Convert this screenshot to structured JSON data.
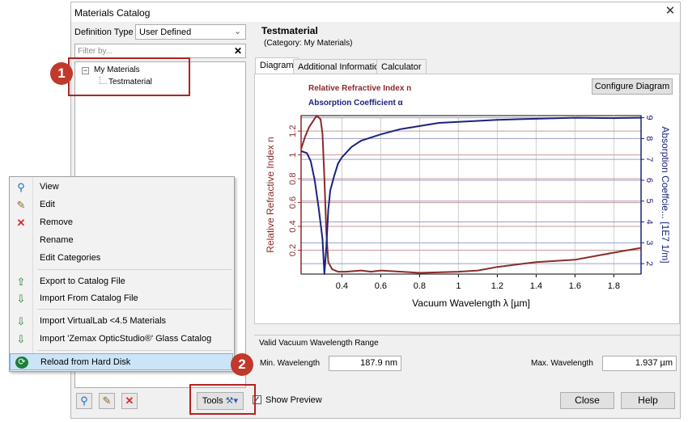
{
  "window": {
    "title": "Materials Catalog",
    "close": "✕"
  },
  "left": {
    "definition_label": "Definition Type",
    "definition_value": "User Defined",
    "filter_placeholder": "Filter by...",
    "filter_clear": "✕",
    "tree": {
      "root": "My Materials",
      "child": "Testmaterial",
      "expander": "−"
    },
    "tools_label": "Tools"
  },
  "material": {
    "name": "Testmaterial",
    "category": "(Category: My Materials)"
  },
  "tabs": [
    "Diagram",
    "Additional Information",
    "Calculator"
  ],
  "diagram": {
    "configure_button": "Configure Diagram",
    "legend_n": "Relative Refractive Index n",
    "legend_alpha": "Absorption Coefficient α"
  },
  "chart_data": {
    "type": "line",
    "xlabel": "Vacuum Wavelength λ [µm]",
    "ylabel": "Relative Refractive Index n",
    "y2label": "Absorption Coeffcie... [1E7 1/m]",
    "xlim": [
      0.19,
      1.94
    ],
    "ylim": [
      0.0,
      1.33
    ],
    "y2lim": [
      1.5,
      9.1
    ],
    "xticks": [
      "0.4",
      "0.6",
      "0.8",
      "1",
      "1.2",
      "1.4",
      "1.6",
      "1.8"
    ],
    "yticks": [
      "0.2",
      "0.4",
      "0.6",
      "0.8",
      "1",
      "1.2"
    ],
    "y2ticks": [
      "2",
      "3",
      "4",
      "5",
      "6",
      "7",
      "8",
      "9"
    ],
    "series": [
      {
        "name": "Relative Refractive Index n",
        "color": "#8b2a2a",
        "axis": "left",
        "x": [
          0.19,
          0.21,
          0.23,
          0.25,
          0.27,
          0.29,
          0.3,
          0.31,
          0.32,
          0.33,
          0.35,
          0.38,
          0.42,
          0.5,
          0.55,
          0.6,
          0.8,
          1.0,
          1.1,
          1.2,
          1.4,
          1.6,
          1.7,
          1.8,
          1.94
        ],
        "y": [
          1.05,
          1.15,
          1.23,
          1.28,
          1.33,
          1.3,
          1.18,
          0.8,
          0.35,
          0.1,
          0.04,
          0.02,
          0.02,
          0.03,
          0.02,
          0.03,
          0.01,
          0.02,
          0.03,
          0.06,
          0.1,
          0.12,
          0.15,
          0.18,
          0.22
        ]
      },
      {
        "name": "Absorption Coefficient α",
        "color": "#1a237e",
        "axis": "right",
        "x": [
          0.19,
          0.22,
          0.24,
          0.26,
          0.28,
          0.3,
          0.31,
          0.32,
          0.33,
          0.34,
          0.36,
          0.38,
          0.4,
          0.45,
          0.5,
          0.6,
          0.7,
          0.8,
          0.9,
          1.0,
          1.2,
          1.4,
          1.6,
          1.8,
          1.94
        ],
        "y": [
          7.4,
          7.3,
          6.9,
          6.0,
          4.7,
          3.2,
          1.5,
          2.8,
          4.6,
          5.5,
          6.2,
          6.8,
          7.1,
          7.6,
          7.9,
          8.2,
          8.45,
          8.6,
          8.75,
          8.8,
          8.9,
          8.95,
          9.0,
          8.98,
          9.0
        ]
      }
    ]
  },
  "range": {
    "title": "Valid Vacuum Wavelength Range",
    "min_label": "Min. Wavelength",
    "min_value": "187.9 nm",
    "max_label": "Max. Wavelength",
    "max_value": "1.937 µm"
  },
  "footer": {
    "show_preview": "Show Preview",
    "close": "Close",
    "help": "Help"
  },
  "context_menu": {
    "items": [
      "View",
      "Edit",
      "Remove",
      "Rename",
      "Edit Categories",
      "Export to Catalog File",
      "Import From Catalog File",
      "Import VirtualLab <4.5 Materials",
      "Import 'Zemax OpticStudio®' Glass Catalog",
      "Reload from Hard Disk"
    ]
  },
  "callouts": [
    "1",
    "2"
  ]
}
